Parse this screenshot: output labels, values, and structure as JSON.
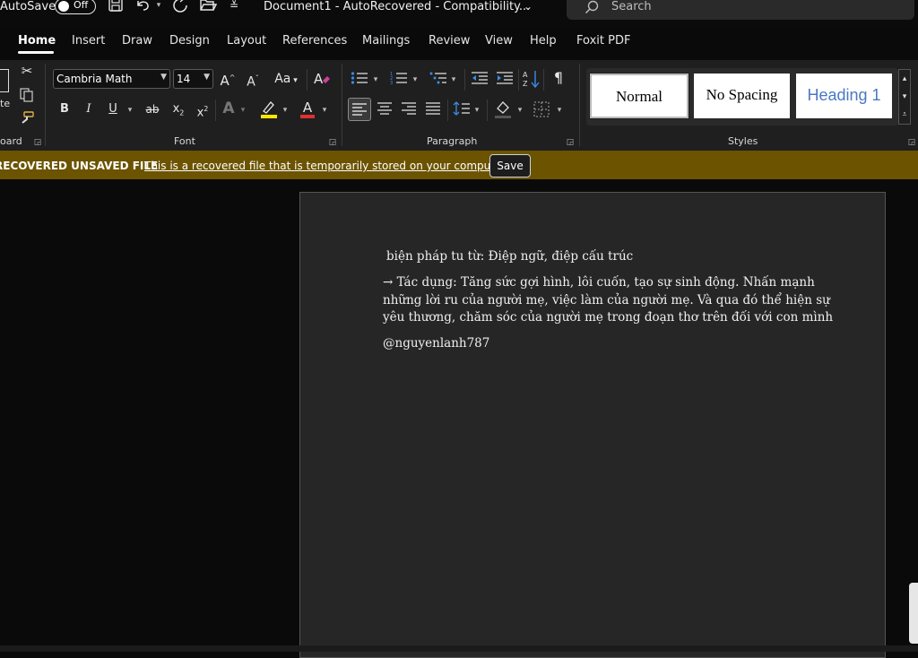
{
  "titlebar": {
    "autosave_label": "AutoSave",
    "autosave_state": "Off",
    "doc_title": "Document1 - AutoRecovered - Compatibility...",
    "search_placeholder": "Search",
    "icons": [
      "save-icon",
      "undo-icon",
      "dropdown-icon",
      "redo-icon",
      "open-icon",
      "customize-icon"
    ]
  },
  "tabs": [
    "Home",
    "Insert",
    "Draw",
    "Design",
    "Layout",
    "References",
    "Mailings",
    "Review",
    "View",
    "Help",
    "Foxit PDF"
  ],
  "active_tab": "Home",
  "ribbon": {
    "clipboard": {
      "label": "oard",
      "paste_fragment": "te"
    },
    "font": {
      "label": "Font",
      "font_name": "Cambria Math",
      "font_size": "14",
      "grow": "A",
      "shrink": "A",
      "case": "Aa",
      "bold": "B",
      "italic": "I",
      "underline": "U",
      "strike": "ab",
      "subscript": "x",
      "superscript": "x",
      "effects": "A",
      "highlight": "A",
      "font_color": "A",
      "highlight_color": "#ffe600",
      "font_color_value": "#e03030"
    },
    "paragraph": {
      "label": "Paragraph",
      "pilcrow": "¶"
    },
    "styles": {
      "label": "Styles",
      "items": [
        "Normal",
        "No Spacing",
        "Heading 1"
      ],
      "heading_color": "#4a78c2"
    }
  },
  "message_bar": {
    "title": "RECOVERED UNSAVED FILE",
    "text": "This is a recovered file that is temporarily stored on your computer.",
    "button": "Save",
    "color": "#6b5300"
  },
  "document": {
    "lines": [
      "biện pháp tu từ: Điệp ngữ, điệp cấu trúc",
      "→ Tác dụng: Tăng sức gợi hình, lôi cuốn, tạo sự sinh động. Nhấn mạnh",
      "những lời ru của người mẹ, việc làm của người mẹ. Và qua đó thể hiện sự",
      "yêu thương, chăm sóc của người mẹ trong đoạn thơ trên đối với con mình",
      "@nguyenlanh787"
    ]
  }
}
